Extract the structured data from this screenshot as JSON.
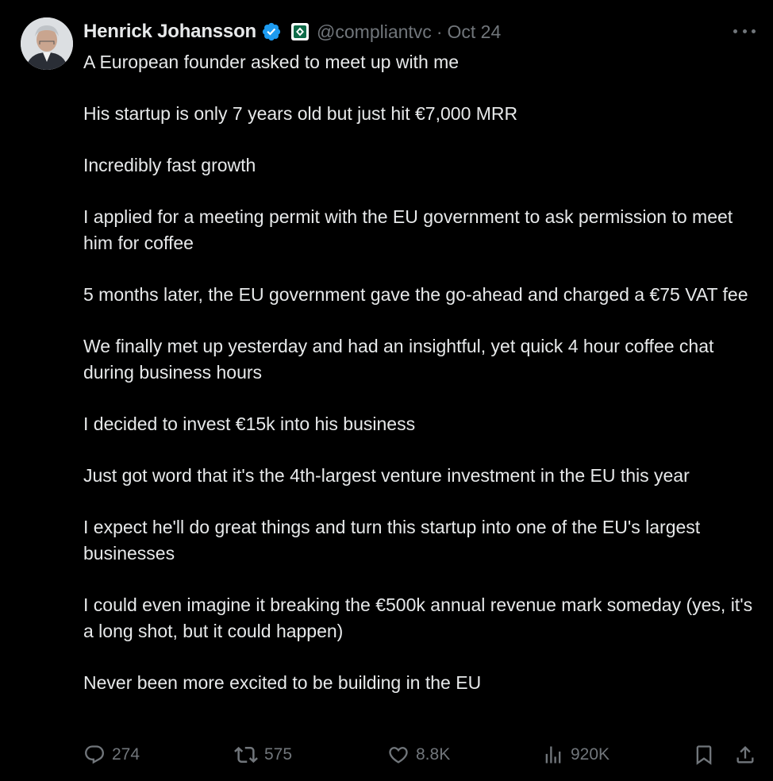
{
  "author": {
    "name": "Henrick Johansson",
    "handle": "@compliantvc",
    "separator": "·",
    "date": "Oct 24",
    "verified_color": "#1d9bf0",
    "affiliate_color": "#0f6b48"
  },
  "tweet": {
    "paragraphs": [
      "A European founder asked to meet up with me",
      "His startup is only 7 years old but just hit €7,000 MRR",
      "Incredibly fast growth",
      "I applied for a meeting permit with the EU government to ask permission to meet him for coffee",
      "5 months later, the EU government gave the go-ahead and charged a €75 VAT fee",
      "We finally met up yesterday and had an insightful, yet quick 4 hour coffee chat during business hours",
      "I decided to invest €15k into his business",
      "Just got word that it's the 4th-largest venture investment in the EU this year",
      "I expect he'll do great things and turn this startup into one of the EU's largest businesses",
      "I could even imagine it breaking the €500k annual revenue mark someday (yes, it's a long shot, but it could happen)",
      "Never been more excited to be building in the EU"
    ]
  },
  "actions": {
    "replies": "274",
    "reposts": "575",
    "likes": "8.8K",
    "views": "920K"
  },
  "icons": {
    "more": "more-icon",
    "reply": "reply-icon",
    "repost": "repost-icon",
    "like": "heart-icon",
    "views": "views-icon",
    "bookmark": "bookmark-icon",
    "share": "share-icon"
  },
  "colors": {
    "background": "#000000",
    "text": "#e7e9ea",
    "secondary": "#71767b"
  }
}
